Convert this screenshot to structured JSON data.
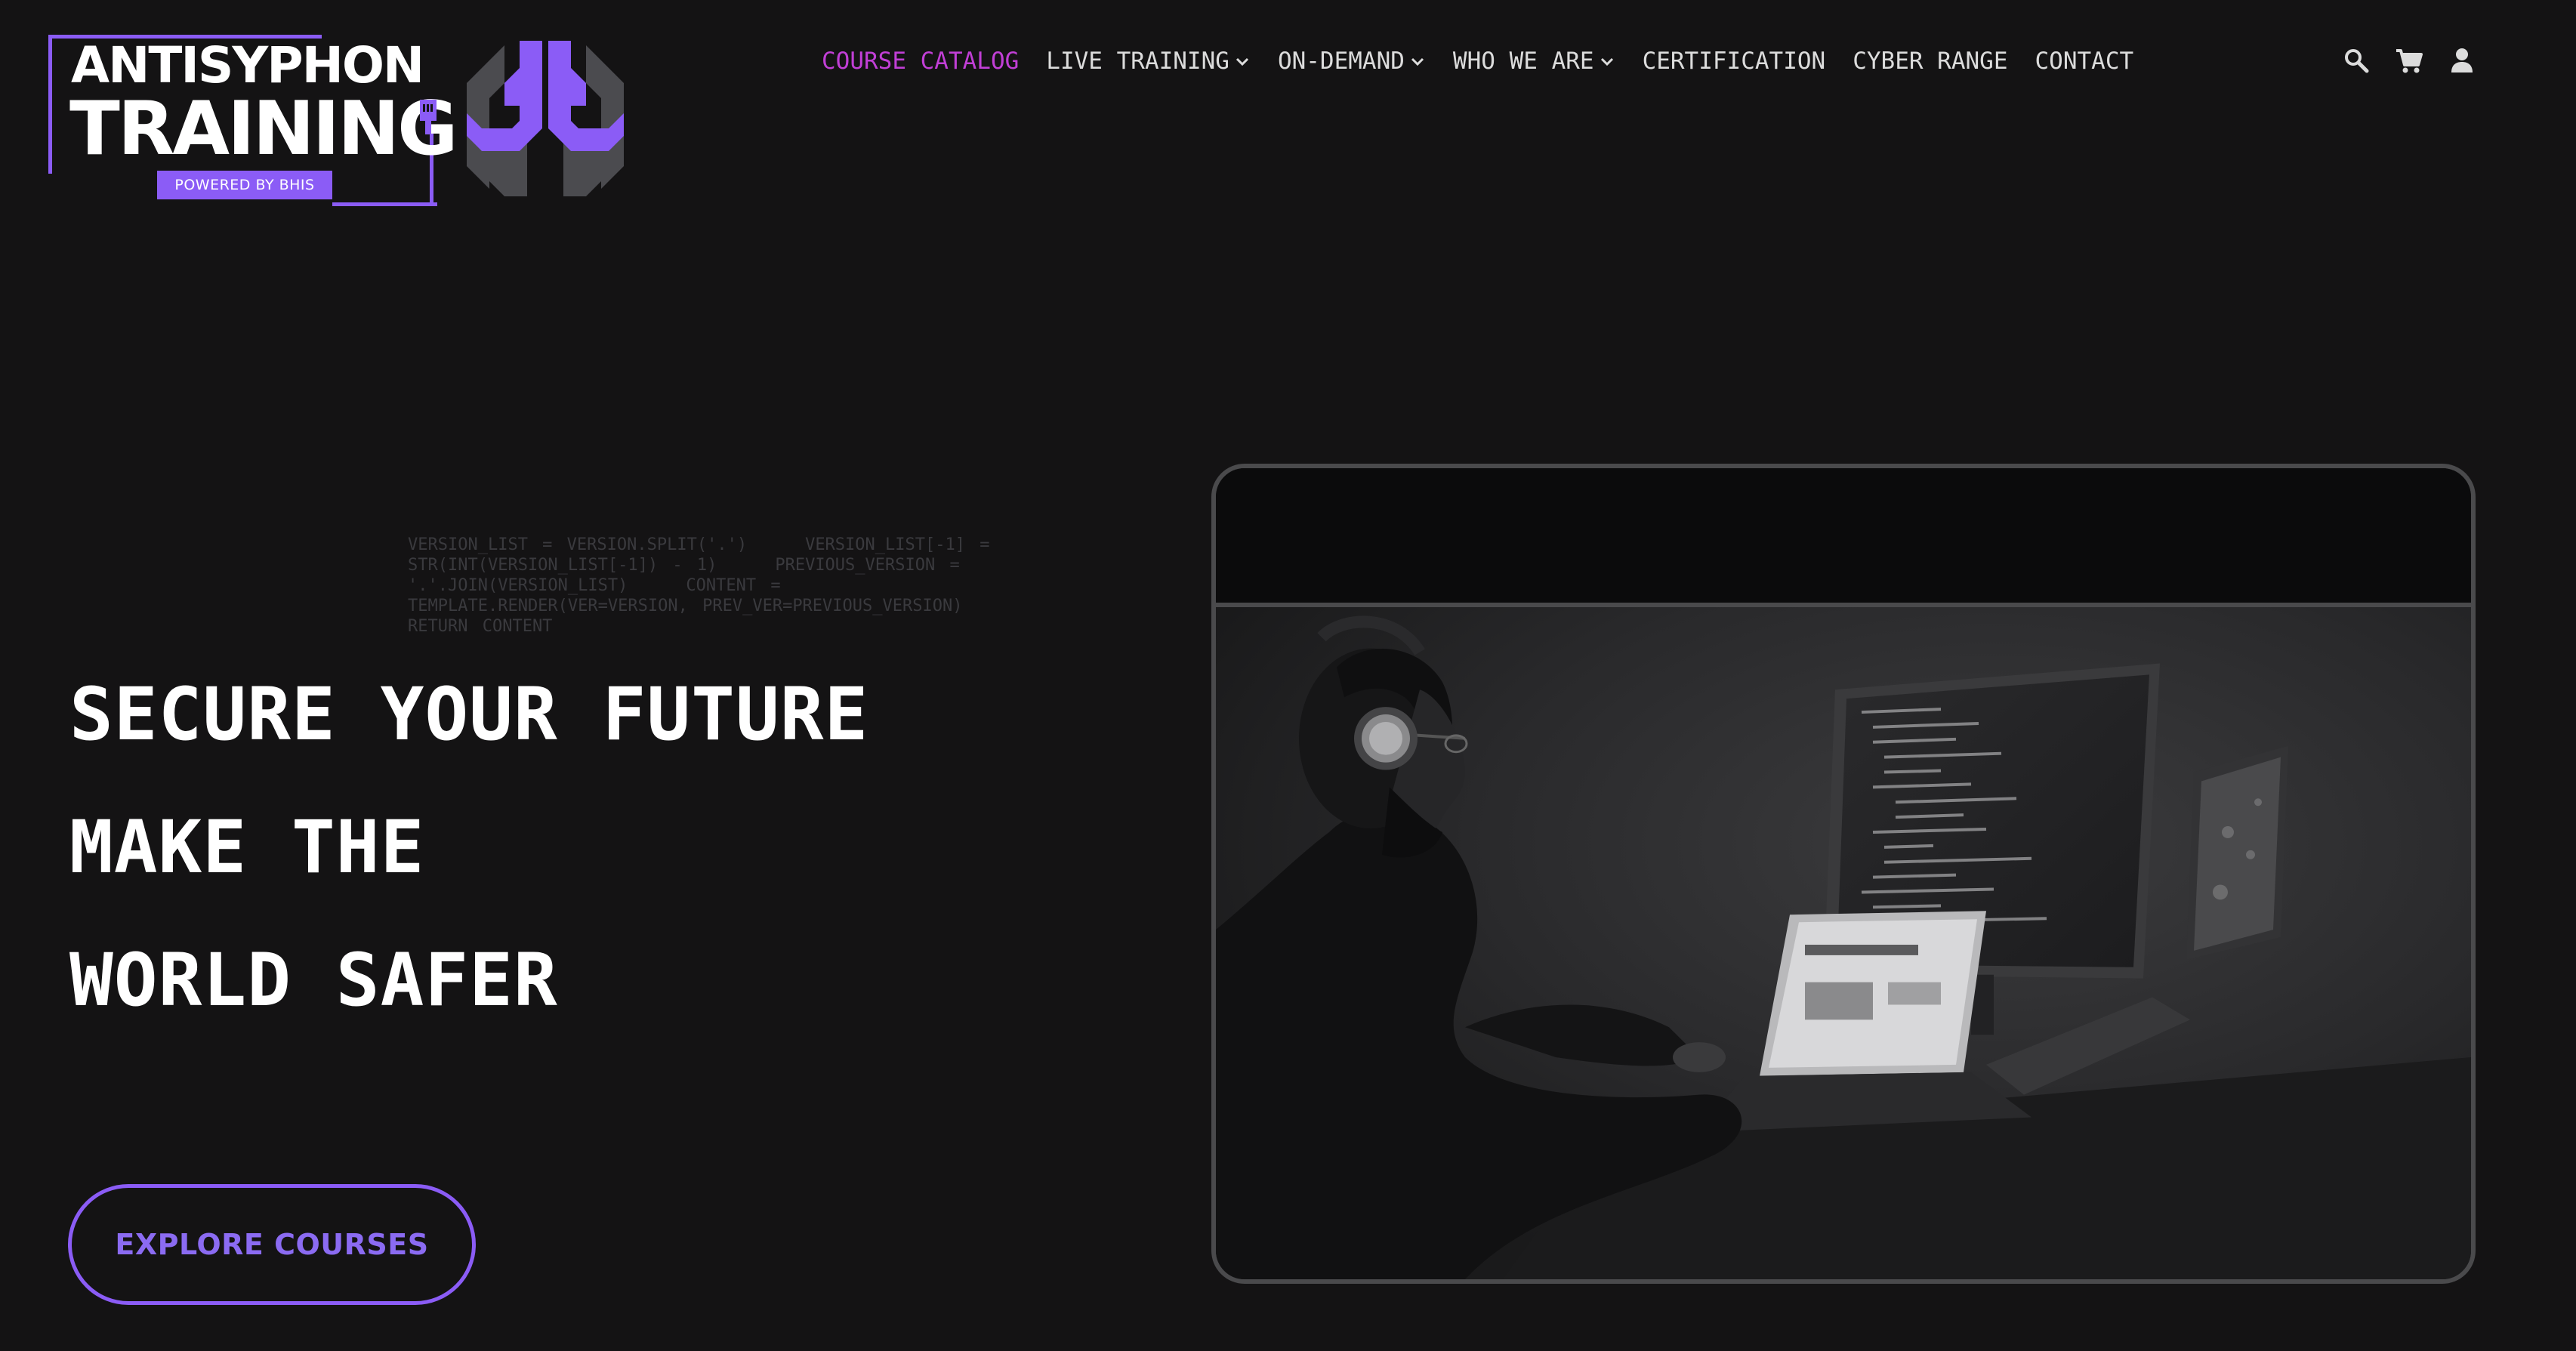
{
  "logo": {
    "line1": "ANTISYPHON",
    "line2": "TRAINING",
    "badge": "POWERED BY BHIS"
  },
  "nav": {
    "items": [
      {
        "label": "COURSE CATALOG",
        "active": true
      },
      {
        "label": "LIVE TRAINING",
        "dropdown": true
      },
      {
        "label": "ON-DEMAND",
        "dropdown": true
      },
      {
        "label": "WHO WE ARE",
        "dropdown": true
      },
      {
        "label": "CERTIFICATION"
      },
      {
        "label": "CYBER RANGE"
      },
      {
        "label": "CONTACT"
      }
    ],
    "icons": [
      "search-icon",
      "cart-icon",
      "user-icon"
    ]
  },
  "hero": {
    "code": "VERSION_LIST = VERSION.SPLIT('.')    VERSION_LIST[-1] = STR(INT(VERSION_LIST[-1]) - 1)    PREVIOUS_VERSION = '.'.JOIN(VERSION_LIST)    CONTENT = TEMPLATE.RENDER(VER=VERSION, PREV_VER=PREVIOUS_VERSION)    RETURN CONTENT",
    "headline": [
      "SECURE YOUR FUTURE",
      "MAKE THE",
      "WORLD SAFER"
    ],
    "cta_label": "EXPLORE COURSES"
  },
  "colors": {
    "background": "#141314",
    "accent": "#8b5cf6",
    "nav_active": "#c13fd6",
    "nav_text": "#dcdcdc"
  }
}
